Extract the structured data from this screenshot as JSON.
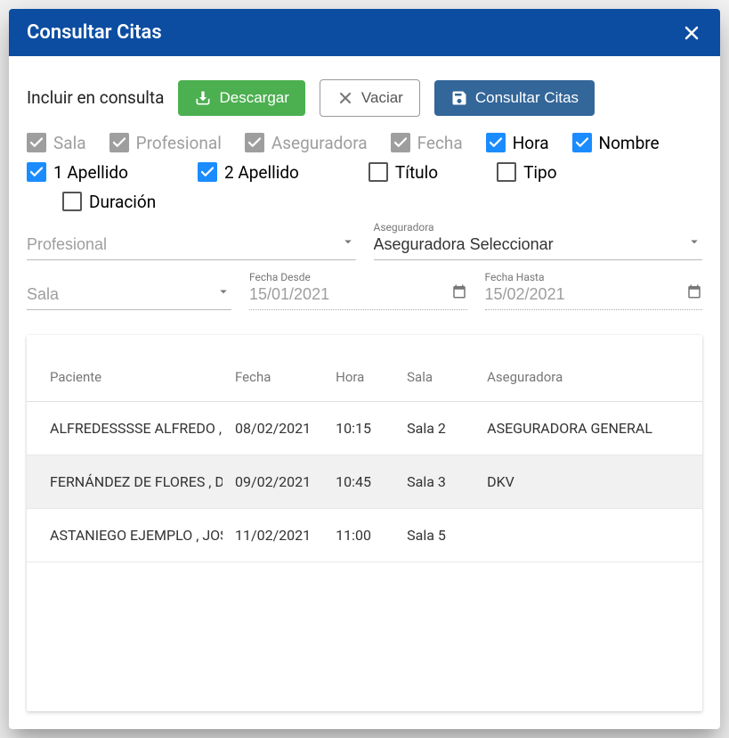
{
  "dialog": {
    "title": "Consultar Citas"
  },
  "actions": {
    "incluir_label": "Incluir en consulta",
    "download_label": "Descargar",
    "clear_label": "Vaciar",
    "consult_label": "Consultar Citas"
  },
  "checkboxes": {
    "sala": "Sala",
    "profesional": "Profesional",
    "aseguradora": "Aseguradora",
    "fecha": "Fecha",
    "hora": "Hora",
    "nombre": "Nombre",
    "apellido1": "1 Apellido",
    "apellido2": "2 Apellido",
    "titulo": "Título",
    "tipo": "Tipo",
    "duracion": "Duración"
  },
  "fields": {
    "profesional_placeholder": "Profesional",
    "aseguradora_label": "Aseguradora",
    "aseguradora_value": "Aseguradora Seleccionar",
    "sala_placeholder": "Sala",
    "fecha_desde_label": "Fecha Desde",
    "fecha_desde_value": "15/01/2021",
    "fecha_hasta_label": "Fecha Hasta",
    "fecha_hasta_value": "15/02/2021"
  },
  "table": {
    "headers": {
      "paciente": "Paciente",
      "fecha": "Fecha",
      "hora": "Hora",
      "sala": "Sala",
      "aseguradora": "Aseguradora"
    },
    "rows": [
      {
        "paciente": "ALFREDESSSSE ALFREDO , ALFREDO",
        "fecha": "08/02/2021",
        "hora": "10:15",
        "sala": "Sala 2",
        "aseguradora": "ASEGURADORA GENERAL"
      },
      {
        "paciente": "FERNÁNDEZ DE FLORES , DIEGO",
        "fecha": "09/02/2021",
        "hora": "10:45",
        "sala": "Sala 3",
        "aseguradora": "DKV"
      },
      {
        "paciente": "ASTANIEGO EJEMPLO , JOSEFINA",
        "fecha": "11/02/2021",
        "hora": "11:00",
        "sala": "Sala 5",
        "aseguradora": ""
      }
    ]
  }
}
